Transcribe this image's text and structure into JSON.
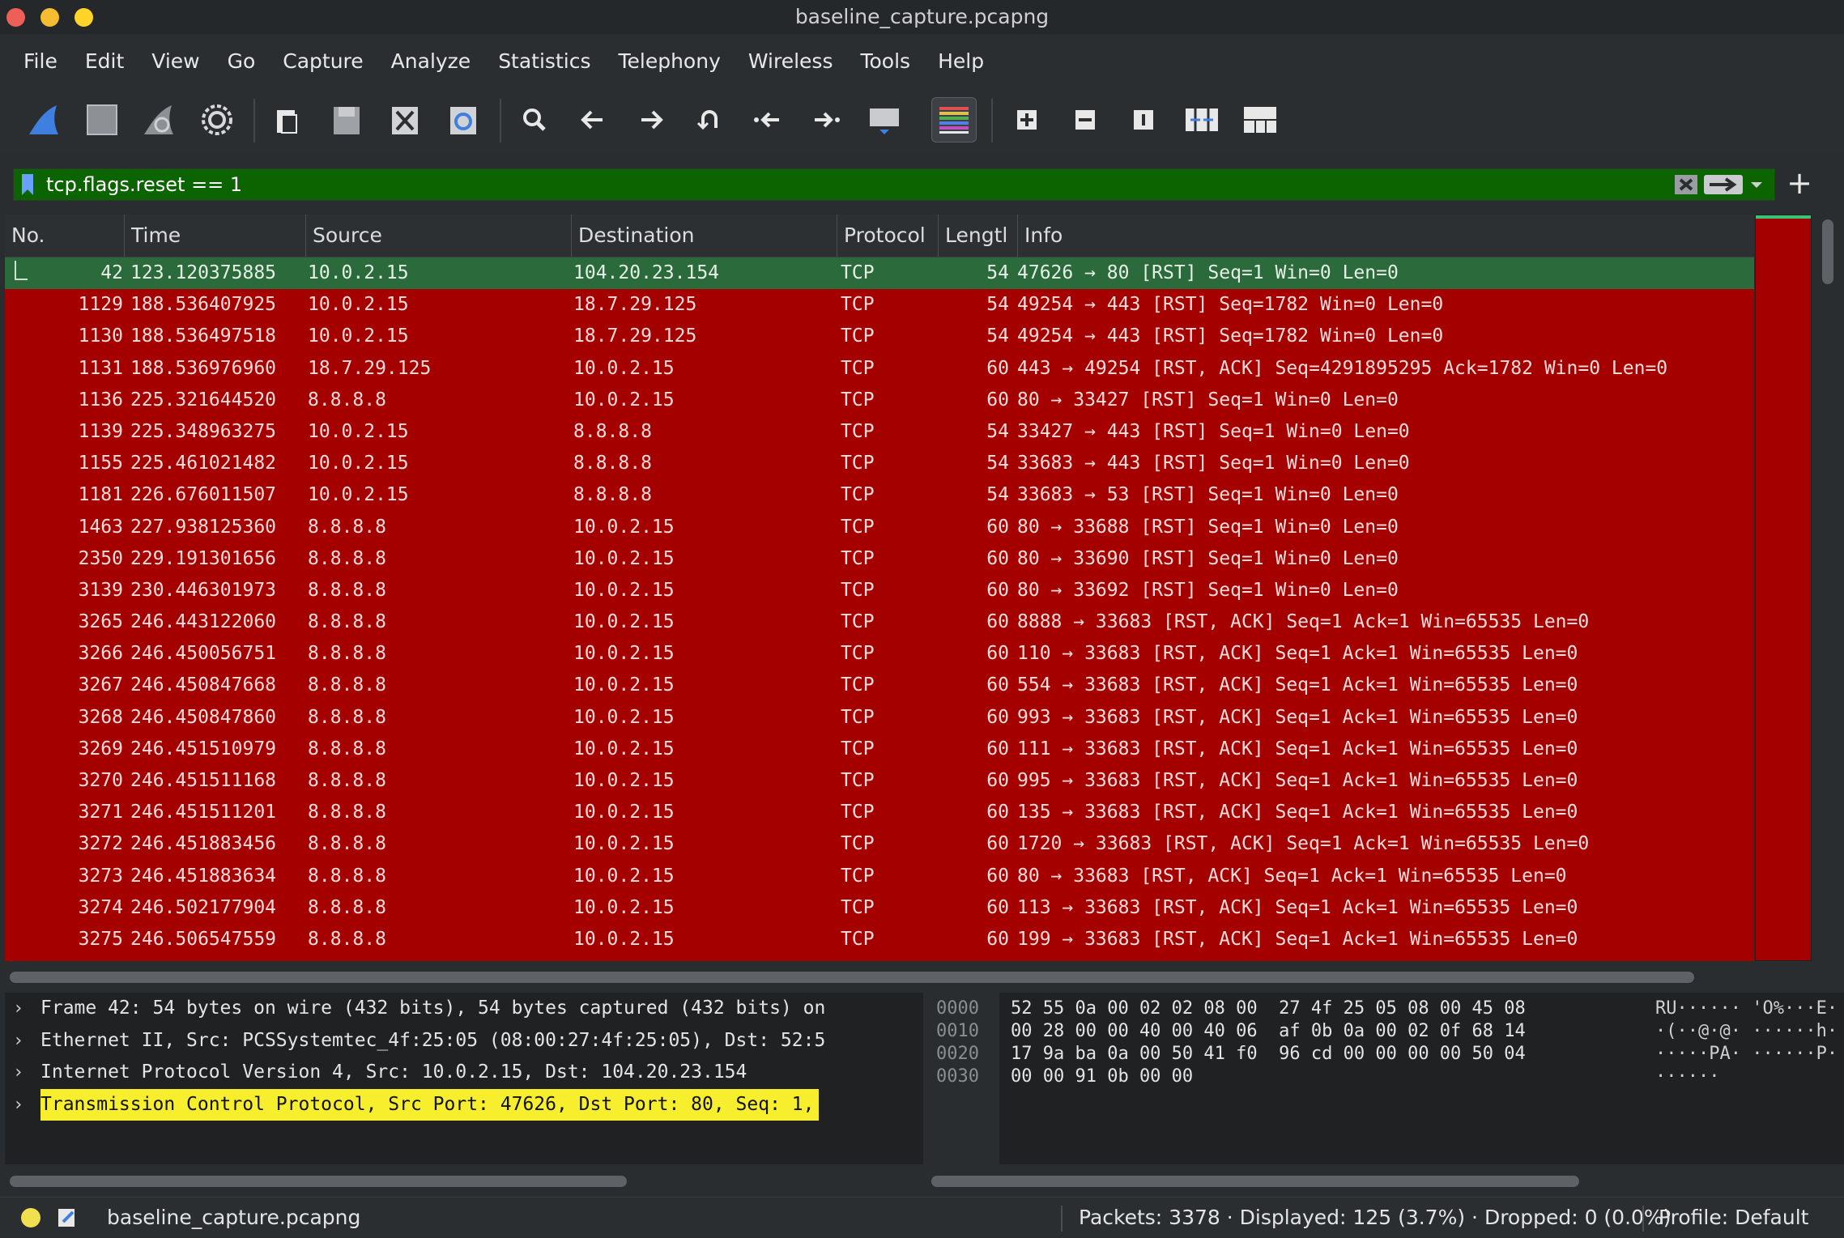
{
  "window": {
    "title": "baseline_capture.pcapng"
  },
  "menu": [
    "File",
    "Edit",
    "View",
    "Go",
    "Capture",
    "Analyze",
    "Statistics",
    "Telephony",
    "Wireless",
    "Tools",
    "Help"
  ],
  "filter": {
    "value": "tcp.flags.reset == 1"
  },
  "columns": {
    "no": "No.",
    "time": "Time",
    "source": "Source",
    "destination": "Destination",
    "protocol": "Protocol",
    "length": "Lengtl",
    "info": "Info"
  },
  "packets": [
    {
      "no": "42",
      "time": "123.120375885",
      "src": "10.0.2.15",
      "dst": "104.20.23.154",
      "proto": "TCP",
      "len": "54",
      "info": "47626 → 80 [RST] Seq=1 Win=0 Len=0"
    },
    {
      "no": "1129",
      "time": "188.536407925",
      "src": "10.0.2.15",
      "dst": "18.7.29.125",
      "proto": "TCP",
      "len": "54",
      "info": "49254 → 443 [RST] Seq=1782 Win=0 Len=0"
    },
    {
      "no": "1130",
      "time": "188.536497518",
      "src": "10.0.2.15",
      "dst": "18.7.29.125",
      "proto": "TCP",
      "len": "54",
      "info": "49254 → 443 [RST] Seq=1782 Win=0 Len=0"
    },
    {
      "no": "1131",
      "time": "188.536976960",
      "src": "18.7.29.125",
      "dst": "10.0.2.15",
      "proto": "TCP",
      "len": "60",
      "info": "443 → 49254 [RST, ACK] Seq=4291895295 Ack=1782 Win=0 Len=0"
    },
    {
      "no": "1136",
      "time": "225.321644520",
      "src": "8.8.8.8",
      "dst": "10.0.2.15",
      "proto": "TCP",
      "len": "60",
      "info": "80 → 33427 [RST] Seq=1 Win=0 Len=0"
    },
    {
      "no": "1139",
      "time": "225.348963275",
      "src": "10.0.2.15",
      "dst": "8.8.8.8",
      "proto": "TCP",
      "len": "54",
      "info": "33427 → 443 [RST] Seq=1 Win=0 Len=0"
    },
    {
      "no": "1155",
      "time": "225.461021482",
      "src": "10.0.2.15",
      "dst": "8.8.8.8",
      "proto": "TCP",
      "len": "54",
      "info": "33683 → 443 [RST] Seq=1 Win=0 Len=0"
    },
    {
      "no": "1181",
      "time": "226.676011507",
      "src": "10.0.2.15",
      "dst": "8.8.8.8",
      "proto": "TCP",
      "len": "54",
      "info": "33683 → 53 [RST] Seq=1 Win=0 Len=0"
    },
    {
      "no": "1463",
      "time": "227.938125360",
      "src": "8.8.8.8",
      "dst": "10.0.2.15",
      "proto": "TCP",
      "len": "60",
      "info": "80 → 33688 [RST] Seq=1 Win=0 Len=0"
    },
    {
      "no": "2350",
      "time": "229.191301656",
      "src": "8.8.8.8",
      "dst": "10.0.2.15",
      "proto": "TCP",
      "len": "60",
      "info": "80 → 33690 [RST] Seq=1 Win=0 Len=0"
    },
    {
      "no": "3139",
      "time": "230.446301973",
      "src": "8.8.8.8",
      "dst": "10.0.2.15",
      "proto": "TCP",
      "len": "60",
      "info": "80 → 33692 [RST] Seq=1 Win=0 Len=0"
    },
    {
      "no": "3265",
      "time": "246.443122060",
      "src": "8.8.8.8",
      "dst": "10.0.2.15",
      "proto": "TCP",
      "len": "60",
      "info": "8888 → 33683 [RST, ACK] Seq=1 Ack=1 Win=65535 Len=0"
    },
    {
      "no": "3266",
      "time": "246.450056751",
      "src": "8.8.8.8",
      "dst": "10.0.2.15",
      "proto": "TCP",
      "len": "60",
      "info": "110 → 33683 [RST, ACK] Seq=1 Ack=1 Win=65535 Len=0"
    },
    {
      "no": "3267",
      "time": "246.450847668",
      "src": "8.8.8.8",
      "dst": "10.0.2.15",
      "proto": "TCP",
      "len": "60",
      "info": "554 → 33683 [RST, ACK] Seq=1 Ack=1 Win=65535 Len=0"
    },
    {
      "no": "3268",
      "time": "246.450847860",
      "src": "8.8.8.8",
      "dst": "10.0.2.15",
      "proto": "TCP",
      "len": "60",
      "info": "993 → 33683 [RST, ACK] Seq=1 Ack=1 Win=65535 Len=0"
    },
    {
      "no": "3269",
      "time": "246.451510979",
      "src": "8.8.8.8",
      "dst": "10.0.2.15",
      "proto": "TCP",
      "len": "60",
      "info": "111 → 33683 [RST, ACK] Seq=1 Ack=1 Win=65535 Len=0"
    },
    {
      "no": "3270",
      "time": "246.451511168",
      "src": "8.8.8.8",
      "dst": "10.0.2.15",
      "proto": "TCP",
      "len": "60",
      "info": "995 → 33683 [RST, ACK] Seq=1 Ack=1 Win=65535 Len=0"
    },
    {
      "no": "3271",
      "time": "246.451511201",
      "src": "8.8.8.8",
      "dst": "10.0.2.15",
      "proto": "TCP",
      "len": "60",
      "info": "135 → 33683 [RST, ACK] Seq=1 Ack=1 Win=65535 Len=0"
    },
    {
      "no": "3272",
      "time": "246.451883456",
      "src": "8.8.8.8",
      "dst": "10.0.2.15",
      "proto": "TCP",
      "len": "60",
      "info": "1720 → 33683 [RST, ACK] Seq=1 Ack=1 Win=65535 Len=0"
    },
    {
      "no": "3273",
      "time": "246.451883634",
      "src": "8.8.8.8",
      "dst": "10.0.2.15",
      "proto": "TCP",
      "len": "60",
      "info": "80 → 33683 [RST, ACK] Seq=1 Ack=1 Win=65535 Len=0"
    },
    {
      "no": "3274",
      "time": "246.502177904",
      "src": "8.8.8.8",
      "dst": "10.0.2.15",
      "proto": "TCP",
      "len": "60",
      "info": "113 → 33683 [RST, ACK] Seq=1 Ack=1 Win=65535 Len=0"
    },
    {
      "no": "3275",
      "time": "246.506547559",
      "src": "8.8.8.8",
      "dst": "10.0.2.15",
      "proto": "TCP",
      "len": "60",
      "info": "199 → 33683 [RST, ACK] Seq=1 Ack=1 Win=65535 Len=0"
    }
  ],
  "details": [
    "Frame 42: 54 bytes on wire (432 bits), 54 bytes captured (432 bits) on",
    "Ethernet II, Src: PCSSystemtec_4f:25:05 (08:00:27:4f:25:05), Dst: 52:5",
    "Internet Protocol Version 4, Src: 10.0.2.15, Dst: 104.20.23.154",
    "Transmission Control Protocol, Src Port: 47626, Dst Port: 80, Seq: 1,"
  ],
  "bytes": [
    {
      "off": "0000",
      "hex": "52 55 0a 00 02 02 08 00  27 4f 25 05 08 00 45 08",
      "ascii": "RU······ 'O%···E·"
    },
    {
      "off": "0010",
      "hex": "00 28 00 00 40 00 40 06  af 0b 0a 00 02 0f 68 14",
      "ascii": "·(··@·@· ······h·"
    },
    {
      "off": "0020",
      "hex": "17 9a ba 0a 00 50 41 f0  96 cd 00 00 00 00 50 04",
      "ascii": "·····PA· ······P·"
    },
    {
      "off": "0030",
      "hex": "00 00 91 0b 00 00",
      "ascii": "······"
    }
  ],
  "status": {
    "file": "baseline_capture.pcapng",
    "packets": "Packets: 3378 · Displayed: 125 (3.7%) · Dropped: 0 (0.0%)",
    "profile": "Profile: Default"
  },
  "colors": {
    "rst_row": "#a50000",
    "selected_row": "#2b6a3a",
    "filter_ok": "#0b6400",
    "highlight": "#f7ef2d"
  },
  "icons": [
    "shark-fin-start-icon",
    "stop-square-icon",
    "shark-fin-restart-icon",
    "gear-options-icon",
    "open-file-icon",
    "save-file-icon",
    "close-file-icon",
    "reload-file-icon",
    "search-icon",
    "arrow-left-icon",
    "arrow-right-icon",
    "go-to-packet-icon",
    "first-packet-icon",
    "last-packet-icon",
    "autoscroll-icon",
    "colorize-icon",
    "zoom-in-icon",
    "zoom-out-icon",
    "zoom-normal-icon",
    "resize-columns-icon",
    "layout-icon"
  ]
}
